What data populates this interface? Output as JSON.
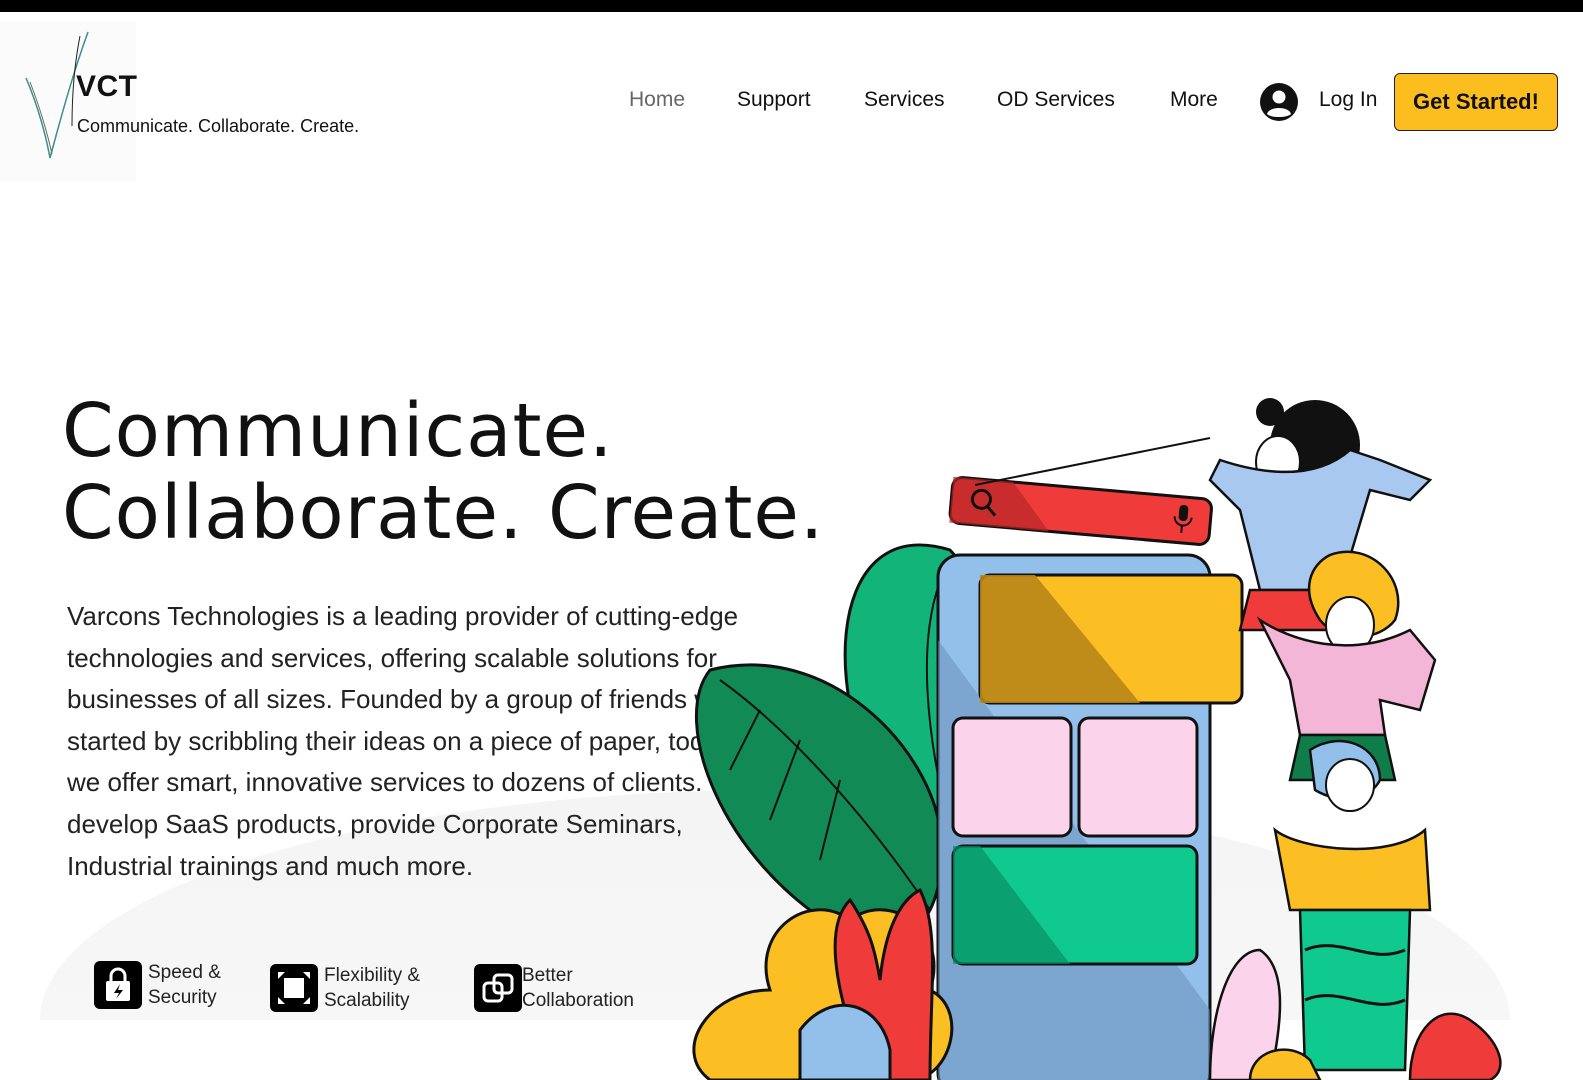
{
  "header": {
    "brand": "VCT",
    "tagline": "Communicate. Collaborate. Create.",
    "nav": [
      {
        "label": "Home",
        "active": true
      },
      {
        "label": "Support",
        "active": false
      },
      {
        "label": "Services",
        "active": false
      },
      {
        "label": "OD Services",
        "active": false
      },
      {
        "label": "More",
        "active": false
      }
    ],
    "login_label": "Log In",
    "cta_label": "Get Started!",
    "cta_color": "#fcbd1e"
  },
  "hero": {
    "title_line1": "Communicate.",
    "title_line2": "Collaborate. Create.",
    "description": "Varcons Technologies is a leading provider of cutting-edge technologies and services, offering scalable solutions for businesses of all sizes. Founded by a group of friends who started by scribbling their ideas on a piece of paper, today we offer smart, innovative services to dozens of clients. We develop SaaS products, provide Corporate Seminars, Industrial trainings and much more.",
    "features": [
      {
        "icon": "lock-bolt-icon",
        "line1": "Speed &",
        "line2": "Security"
      },
      {
        "icon": "expand-square-icon",
        "line1": "Flexibility &",
        "line2": "Scalability"
      },
      {
        "icon": "linked-squares-icon",
        "line1": "Better",
        "line2": "Collaboration"
      }
    ]
  },
  "colors": {
    "search_bar": "#f03b3b",
    "card_yellow": "#fbbf24",
    "card_pink": "#fbd3ea",
    "card_green": "#10c98f",
    "leaf_green": "#12a36a",
    "phone_blue": "#93c0ea"
  }
}
